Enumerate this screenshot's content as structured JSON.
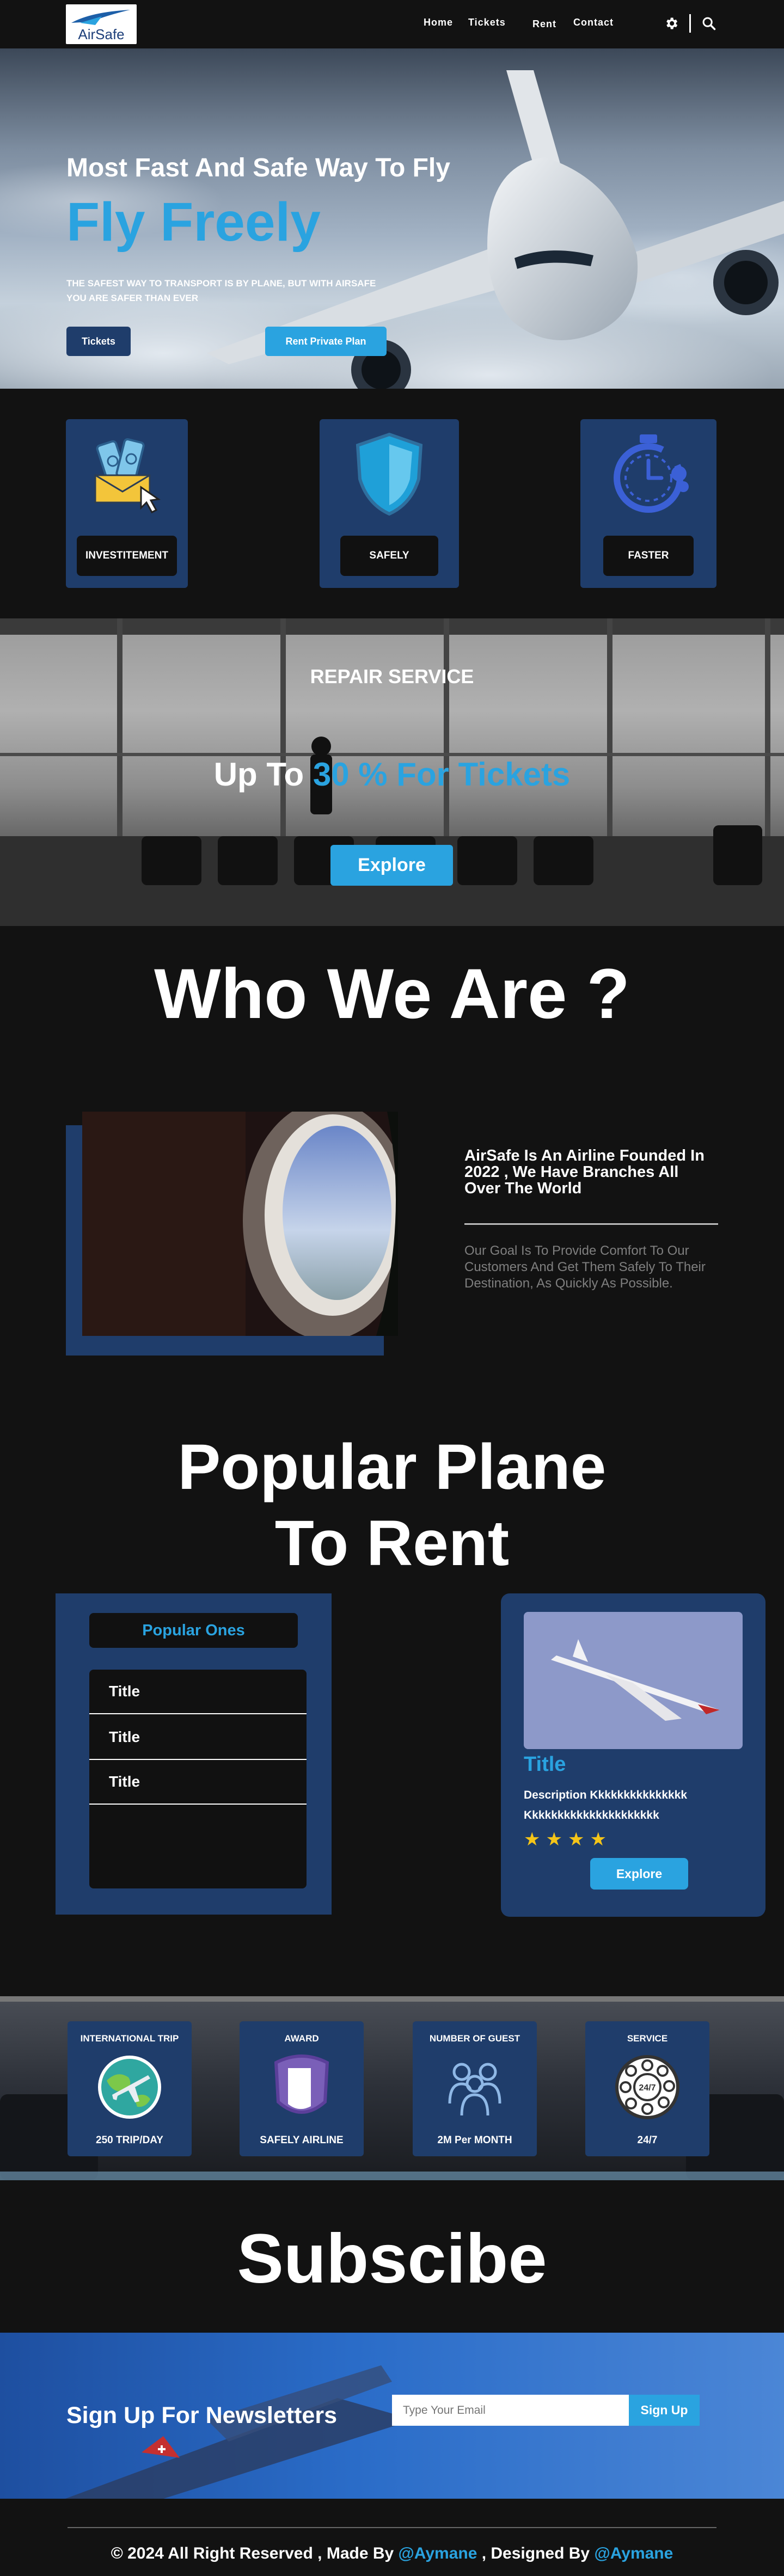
{
  "nav": {
    "logo_text": "AirSafe",
    "links": [
      "Home",
      "Tickets",
      "Rent",
      "Contact"
    ]
  },
  "hero": {
    "heading": "Most Fast And Safe Way To Fly",
    "title": "Fly Freely",
    "subtitle_line1": "THE SAFEST WAY TO TRANSPORT IS BY PLANE, BUT WITH AIRSAFE",
    "subtitle_line2": "YOU ARE SAFER THAN EVER",
    "btn_tickets": "Tickets",
    "btn_rent": "Rent Private Plan"
  },
  "features": [
    {
      "label": "INVESTITEMENT",
      "icon": "money-envelope-icon"
    },
    {
      "label": "SAFELY",
      "icon": "shield-icon"
    },
    {
      "label": "FASTER",
      "icon": "stopwatch-icon"
    }
  ],
  "repair": {
    "title": "REPAIR SERVICE",
    "offer_prefix": "Up To ",
    "offer_highlight": "30 % For Tickets",
    "btn": "Explore"
  },
  "who": {
    "heading": "Who We Are ?",
    "founded": "AirSafe Is An Airline Founded In 2022 , We Have Branches All Over The World",
    "goal": "Our Goal Is To Provide Comfort To Our Customers And Get Them Safely To Their Destination, As Quickly As Possible."
  },
  "popular": {
    "heading_line1": "Popular Plane",
    "heading_line2": "To Rent",
    "list_title": "Popular Ones",
    "items": [
      "Title",
      "Title",
      "Title"
    ],
    "card_title": "Title",
    "card_desc_line1": "Description Kkkkkkkkkkkkkkk",
    "card_desc_line2": "Kkkkkkkkkkkkkkkkkkkkk",
    "rating": 4,
    "btn": "Explore"
  },
  "stats": [
    {
      "title": "INTERNATIONAL TRIP",
      "value": "250 TRIP/DAY",
      "icon": "globe-plane-icon"
    },
    {
      "title": "AWARD",
      "value": "SAFELY AIRLINE",
      "icon": "badge-icon"
    },
    {
      "title": "NUMBER OF GUEST",
      "value": "2M Per MONTH",
      "icon": "people-icon"
    },
    {
      "title": "SERVICE",
      "value": "24/7",
      "icon": "rotary-phone-icon"
    }
  ],
  "subscribe": {
    "heading": "Subscibe",
    "newsletter": "Sign Up For Newsletters",
    "placeholder": "Type Your Email",
    "btn": "Sign Up"
  },
  "footer": {
    "prefix": "© 2024 All Right Reserved , Made By ",
    "made_by": "@Aymane",
    "mid": " , Designed By ",
    "designed_by": "@Aymane"
  },
  "colors": {
    "accent": "#2aa3e0",
    "panel": "#1f3d6b",
    "background": "#121212",
    "star": "#f5c518"
  }
}
